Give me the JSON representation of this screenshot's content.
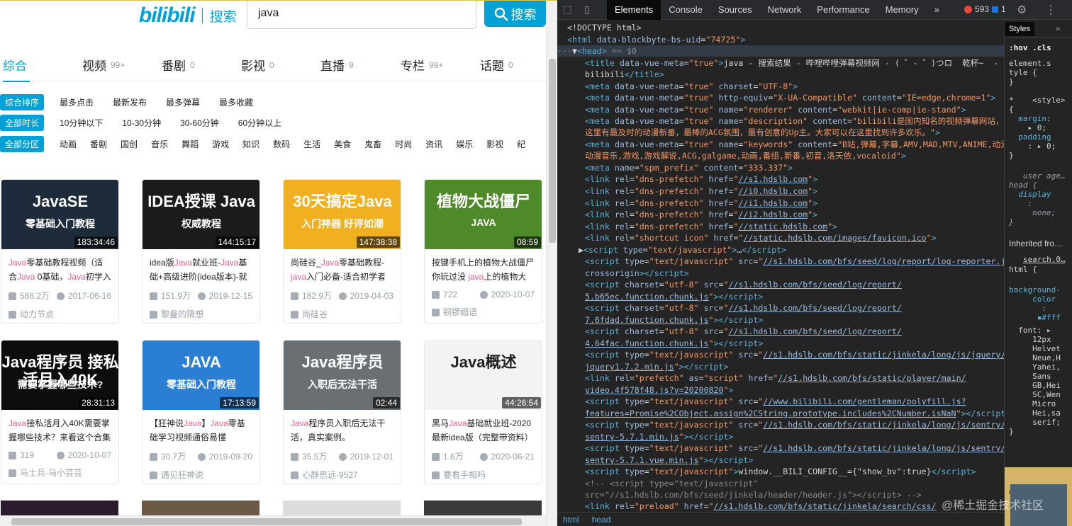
{
  "site": {
    "logo": "bilibili",
    "logo_sub": "搜索",
    "search_value": "java",
    "search_button": "搜索"
  },
  "tabs": [
    {
      "label": "综合",
      "count": ""
    },
    {
      "label": "视频",
      "count": "99+"
    },
    {
      "label": "番剧",
      "count": "0"
    },
    {
      "label": "影视",
      "count": "0"
    },
    {
      "label": "直播",
      "count": "9"
    },
    {
      "label": "专栏",
      "count": "99+"
    },
    {
      "label": "话题",
      "count": "0"
    }
  ],
  "filters": {
    "order": {
      "active": "综合排序",
      "options": [
        "最多点击",
        "最新发布",
        "最多弹幕",
        "最多收藏"
      ]
    },
    "duration": {
      "active": "全部时长",
      "options": [
        "10分钟以下",
        "10-30分钟",
        "30-60分钟",
        "60分钟以上"
      ]
    },
    "zone": {
      "active": "全部分区",
      "options": [
        "动画",
        "番剧",
        "国创",
        "音乐",
        "舞蹈",
        "游戏",
        "知识",
        "数码",
        "生活",
        "美食",
        "鬼畜",
        "时尚",
        "资讯",
        "娱乐",
        "影视",
        "纪"
      ]
    }
  },
  "videos": [
    {
      "thumb_title": "JavaSE",
      "thumb_sub": "零基础入门教程",
      "duration": "183:34:46",
      "title_parts": [
        [
          "Java",
          1
        ],
        [
          "零基础教程视频（适合",
          0
        ],
        [
          "Java",
          1
        ],
        [
          " 0基础，",
          0
        ],
        [
          "Java",
          1
        ],
        [
          "初学入",
          0
        ]
      ],
      "plays": "586.2万",
      "date": "2017-06-16",
      "uploader": "动力节点",
      "color": "#1d2b3a"
    },
    {
      "thumb_title": "IDEA授课 Java",
      "thumb_sub": "权威教程",
      "duration": "144:15:17",
      "title_parts": [
        [
          "idea版",
          0
        ],
        [
          "Java",
          1
        ],
        [
          "就业班-",
          0
        ],
        [
          "Java",
          1
        ],
        [
          "基础+高级进阶(idea版本)-就",
          0
        ]
      ],
      "plays": "151.9万",
      "date": "2019-12-15",
      "uploader": "黎曼的猜想",
      "color": "#1b1b1b"
    },
    {
      "thumb_title": "30天搞定Java",
      "thumb_sub": "入门神器  好评如潮",
      "duration": "147:38:38",
      "title_parts": [
        [
          "尚硅谷_",
          0
        ],
        [
          "Java",
          1
        ],
        [
          "零基础教程-",
          0
        ],
        [
          "java",
          1
        ],
        [
          "入门必备-适合初学者的",
          0
        ]
      ],
      "plays": "182.9万",
      "date": "2019-04-03",
      "uploader": "尚硅谷",
      "color": "#f0b020"
    },
    {
      "thumb_title": "植物大战僵尸",
      "thumb_sub": "JAVA",
      "duration": "08:59",
      "title_parts": [
        [
          "按键手机上的植物大战僵尸 你玩过没 ",
          0
        ],
        [
          "java",
          1
        ],
        [
          "上的植物大战",
          0
        ]
      ],
      "plays": "722",
      "date": "2020-10-07",
      "uploader": "铜锣细语",
      "color": "#4f8a2a"
    },
    {
      "thumb_title": "Java程序员 接私活月入40K",
      "thumb_sub": "需要掌握哪些技术?",
      "duration": "28:31:13",
      "title_parts": [
        [
          "Java",
          1
        ],
        [
          "接私活月入40K需要掌握哪些技术？来看这个合集",
          0
        ]
      ],
      "plays": "319",
      "date": "2020-10-07",
      "uploader": "马士兵-马小芸芸",
      "color": "#0d0d0d"
    },
    {
      "thumb_title": "JAVA",
      "thumb_sub": "零基础入门教程",
      "duration": "17:13:59",
      "title_parts": [
        [
          "【狂神说",
          0
        ],
        [
          "Java",
          1
        ],
        [
          "】",
          0
        ],
        [
          "Java",
          1
        ],
        [
          "零基础学习视频通俗易懂",
          0
        ]
      ],
      "plays": "30.7万",
      "date": "2019-09-20",
      "uploader": "遇见狂神说",
      "color": "#2a7fd4"
    },
    {
      "thumb_title": "Java程序员",
      "thumb_sub": "入职后无法干活",
      "duration": "02:44",
      "title_parts": [
        [
          "Java",
          1
        ],
        [
          "程序员入职后无法干活，真实案例。",
          0
        ]
      ],
      "plays": "35.5万",
      "date": "2019-12-01",
      "uploader": "心静思远-9527",
      "color": "#6a6f74"
    },
    {
      "thumb_title": "Java概述",
      "thumb_sub": "",
      "duration": "44:26:54",
      "title_parts": [
        [
          "黑马",
          0
        ],
        [
          "Java",
          1
        ],
        [
          "基础就业班-2020最新idea版（完整带资料）",
          0
        ]
      ],
      "plays": "1.6万",
      "date": "2020-06-21",
      "uploader": "要看手相吗",
      "color": "#f3f3f3"
    }
  ],
  "devtools": {
    "tabs": [
      "Elements",
      "Console",
      "Sources",
      "Network",
      "Performance",
      "Memory"
    ],
    "errors": "593",
    "messages": "1",
    "side_tabs": [
      "Styles"
    ],
    "breadcrumbs": [
      "html",
      "head"
    ],
    "selected_suffix": " == $0"
  },
  "watermark": "@稀土掘金技术社区"
}
